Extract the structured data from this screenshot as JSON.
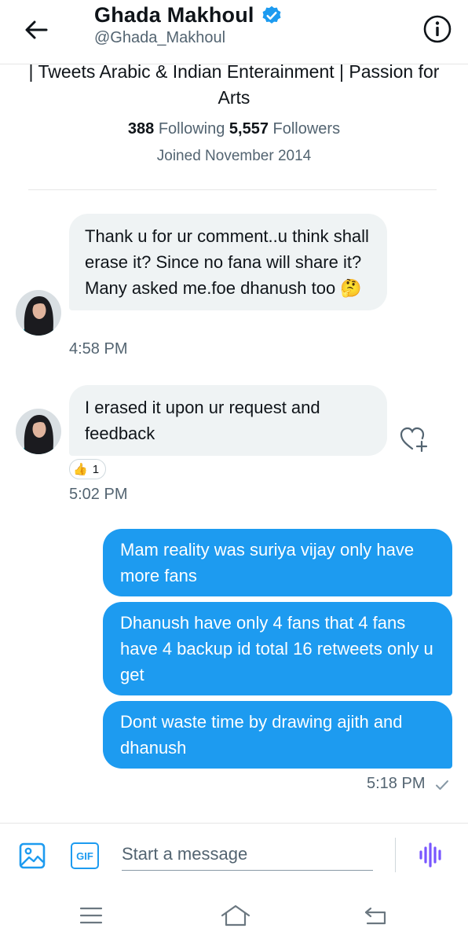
{
  "header": {
    "name": "Ghada Makhoul",
    "handle": "@Ghada_Makhoul",
    "back_icon": "arrow-left-icon",
    "info_icon": "info-circle-icon",
    "verified_icon": "verified-badge-icon"
  },
  "profile": {
    "bio": "| Tweets Arabic & Indian Enterainment | Passion for Arts",
    "following_count": "388",
    "following_label": "Following",
    "followers_count": "5,557",
    "followers_label": "Followers",
    "joined": "Joined November 2014"
  },
  "messages": [
    {
      "direction": "in",
      "text": "Thank u for ur comment..u think shall erase it? Since no fana will share it? Many asked me.foe dhanush too 🤔",
      "time": "4:58 PM"
    },
    {
      "direction": "in",
      "text": "I erased it upon ur request and feedback",
      "time": "5:02 PM",
      "reaction": {
        "emoji": "👍",
        "count": "1"
      }
    },
    {
      "direction": "out",
      "text": "Mam reality was suriya vijay only have more fans"
    },
    {
      "direction": "out",
      "text": "Dhanush have only 4 fans that 4 fans have 4 backup id total 16 retweets only u get"
    },
    {
      "direction": "out",
      "text": "Dont waste time by drawing ajith and dhanush",
      "time": "5:18 PM",
      "status_icon": "sent-check-icon"
    }
  ],
  "composer": {
    "placeholder": "Start a message",
    "gif_label": "GIF",
    "media_icon": "image-icon",
    "voice_icon": "voice-waveform-icon"
  },
  "colors": {
    "accent": "#1d9bf0",
    "incoming_bubble": "#eff3f4",
    "voice": "#7856ff",
    "muted_text": "#536471"
  }
}
